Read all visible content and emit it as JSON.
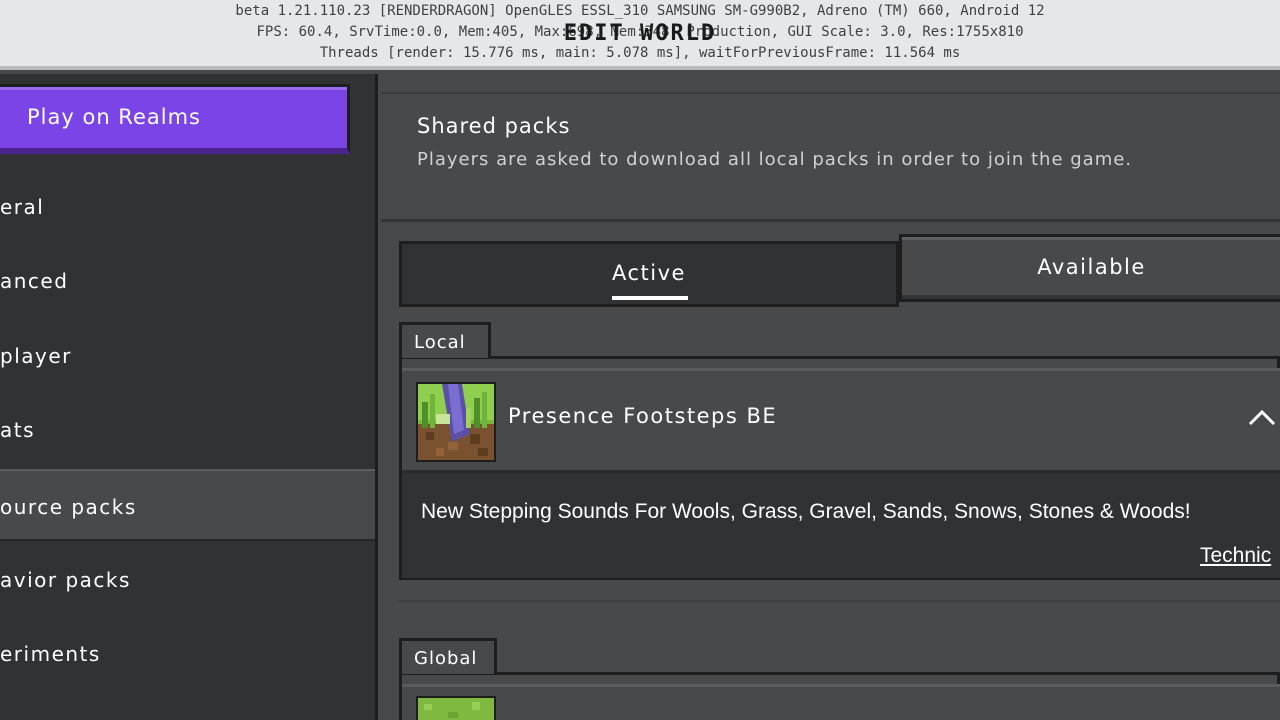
{
  "debug": {
    "line1": "beta 1.21.110.23 [RENDERDRAGON] OpenGLES ESSL_310 SAMSUNG SM-G990B2, Adreno (TM) 660, Android 12",
    "line2": "FPS: 60.4, SrvTime:0.0, Mem:405, Max:698, Mem:348, Production, GUI Scale: 3.0, Res:1755x810",
    "line3": "Threads [render: 15.776 ms, main: 5.078 ms], waitForPreviousFrame: 11.564 ms",
    "overlay_title": "EDIT WORLD"
  },
  "sidebar": {
    "realms_label": "Play on Realms",
    "items": [
      {
        "label": "eral"
      },
      {
        "label": "anced"
      },
      {
        "label": "player"
      },
      {
        "label": "ats"
      },
      {
        "label": "ource packs",
        "selected": true
      },
      {
        "label": "avior packs"
      },
      {
        "label": "eriments"
      }
    ]
  },
  "shared_packs": {
    "title": "Shared packs",
    "description": "Players are asked to download all local packs in order to join the game."
  },
  "tabs": {
    "active_label": "Active",
    "available_label": "Available"
  },
  "local": {
    "label": "Local",
    "pack": {
      "name": "Presence Footsteps BE",
      "description": "New Stepping Sounds For Wools, Grass, Gravel, Sands, Snows, Stones & Woods!",
      "technical_link": "Technic",
      "icon": "grass-block-icon",
      "expanded": true
    }
  },
  "global": {
    "label": "Global",
    "icon": "grass-block-icon"
  },
  "colors": {
    "realms": "#7a44e6",
    "sidebar": "#313233",
    "content": "#48494a",
    "debug_bar": "#e6e7e8"
  }
}
